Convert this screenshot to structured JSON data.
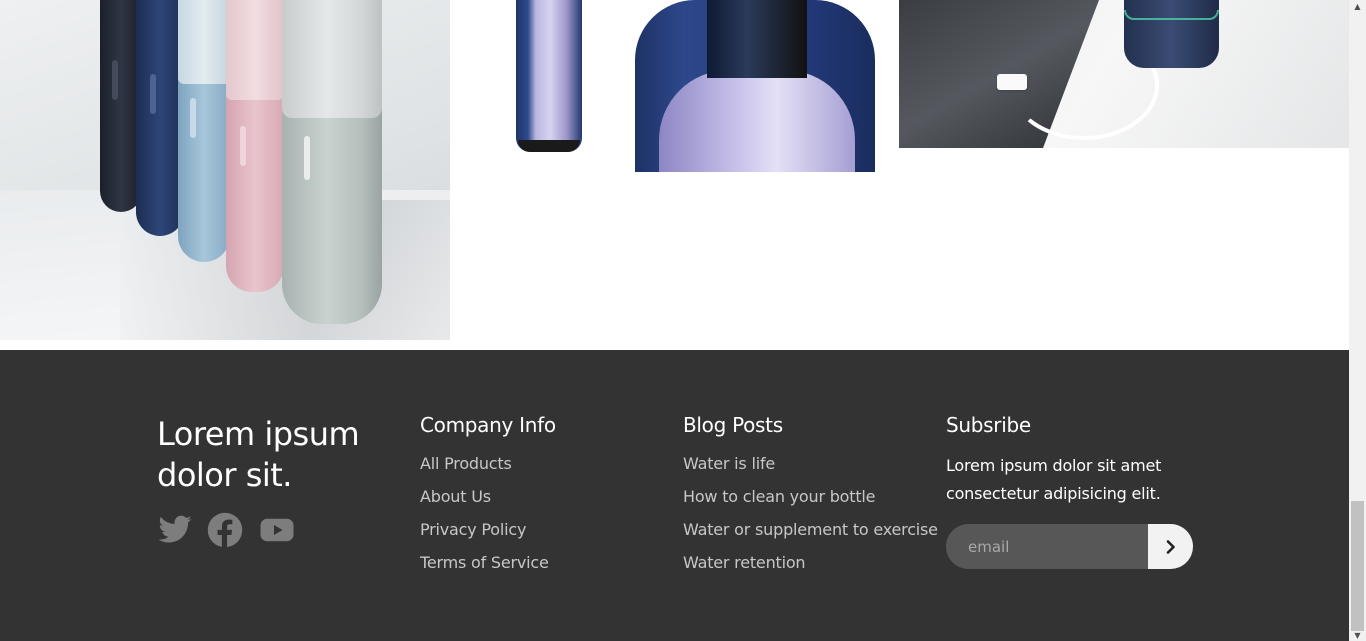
{
  "gallery": {
    "images": [
      {
        "name": "colored-bottles-photo"
      },
      {
        "name": "bottle-cutaway-photo"
      },
      {
        "name": "bottle-charger-photo"
      }
    ]
  },
  "footer": {
    "brand": {
      "title": "Lorem ipsum dolor sit."
    },
    "social": [
      {
        "icon": "twitter-icon"
      },
      {
        "icon": "facebook-icon"
      },
      {
        "icon": "youtube-icon"
      }
    ],
    "company": {
      "title": "Company Info",
      "links": [
        "All Products",
        "About Us",
        "Privacy Policy",
        "Terms of Service"
      ]
    },
    "blog": {
      "title": "Blog Posts",
      "links": [
        "Water is life",
        "How to clean your bottle",
        "Water or supplement to exercise",
        "Water retention"
      ]
    },
    "subscribe": {
      "title": "Subsribe",
      "text": "Lorem ipsum dolor sit amet consectetur adipisicing elit.",
      "placeholder": "email",
      "submit_icon": "chevron-right-icon"
    }
  },
  "colors": {
    "footer_bg": "#333333",
    "input_bg": "#575757",
    "link": "#c7c7c7"
  }
}
